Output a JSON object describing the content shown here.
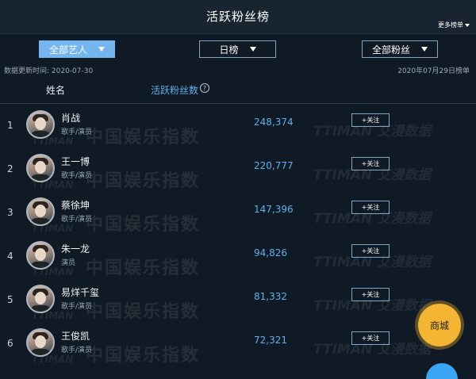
{
  "header": {
    "title": "活跃粉丝榜",
    "more_label": "更多榜单"
  },
  "filters": [
    {
      "label": "全部艺人",
      "active": true
    },
    {
      "label": "日榜",
      "active": false
    },
    {
      "label": "全部粉丝",
      "active": false
    }
  ],
  "meta": {
    "update_time": "数据更新时间: 2020-07-30",
    "board_date": "2020年07月29日榜单"
  },
  "columns": {
    "name": "姓名",
    "fans": "活跃粉丝数",
    "help_icon": "?"
  },
  "rows": [
    {
      "rank": "1",
      "name": "肖战",
      "role": "歌手/演员",
      "fans": "248,374",
      "action": "+关注"
    },
    {
      "rank": "2",
      "name": "王一博",
      "role": "歌手/演员",
      "fans": "220,777",
      "action": "+关注"
    },
    {
      "rank": "3",
      "name": "蔡徐坤",
      "role": "歌手/演员",
      "fans": "147,396",
      "action": "+关注"
    },
    {
      "rank": "4",
      "name": "朱一龙",
      "role": "演员",
      "fans": "94,826",
      "action": "+关注"
    },
    {
      "rank": "5",
      "name": "易烊千玺",
      "role": "歌手/演员",
      "fans": "81,332",
      "action": "+关注"
    },
    {
      "rank": "6",
      "name": "王俊凯",
      "role": "歌手/演员",
      "fans": "72,321",
      "action": "+关注"
    }
  ],
  "watermark": {
    "text": "中国娱乐指数",
    "brand": "TTIMAN 艾漫数据",
    "brand_short": "TTIMAN"
  },
  "shop_button": "商城",
  "colors": {
    "accent": "#74b7f0",
    "fans_blue": "#5fb0ee",
    "shop": "#f3b532",
    "background": "#0f1a24"
  },
  "icons": {
    "more": "caret-down-icon",
    "filter": "caret-down-icon",
    "help": "question-circle-icon",
    "avatar": "avatar-icon"
  }
}
